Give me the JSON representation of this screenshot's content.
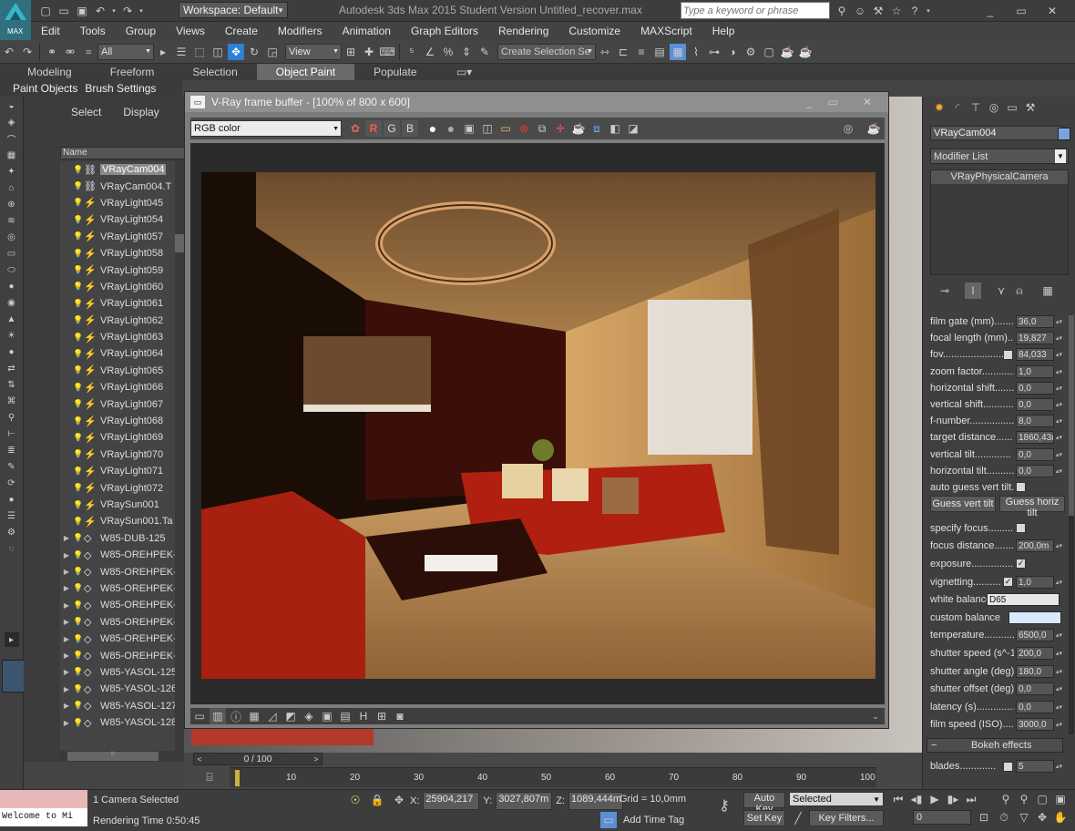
{
  "app": {
    "title": "Autodesk 3ds Max  2015   Student Version   Untitled_recover.max",
    "workspace": "Workspace: Default",
    "search_placeholder": "Type a keyword or phrase",
    "logo": "MAX"
  },
  "menu": [
    "Edit",
    "Tools",
    "Group",
    "Views",
    "Create",
    "Modifiers",
    "Animation",
    "Graph Editors",
    "Rendering",
    "Customize",
    "MAXScript",
    "Help"
  ],
  "toolbar": {
    "filter": "All",
    "ref_coord": "View",
    "selection_set": "Create Selection Se"
  },
  "ribbon": {
    "tabs": [
      "Modeling",
      "Freeform",
      "Selection",
      "Object Paint",
      "Populate"
    ],
    "active": "Object Paint",
    "subtabs": [
      "Paint Objects",
      "Brush Settings"
    ]
  },
  "explorer": {
    "tabs": [
      "Select",
      "Display"
    ],
    "column": "Name",
    "nodes": [
      {
        "label": "VRayCam004",
        "type": "camera",
        "selected": true,
        "expandable": false
      },
      {
        "label": "VRayCam004.T",
        "type": "camera",
        "selected": false,
        "expandable": false
      },
      {
        "label": "VRayLight045",
        "type": "light",
        "selected": false,
        "expandable": false
      },
      {
        "label": "VRayLight054",
        "type": "light",
        "selected": false,
        "expandable": false
      },
      {
        "label": "VRayLight057",
        "type": "light",
        "selected": false,
        "expandable": false
      },
      {
        "label": "VRayLight058",
        "type": "light",
        "selected": false,
        "expandable": false
      },
      {
        "label": "VRayLight059",
        "type": "light",
        "selected": false,
        "expandable": false
      },
      {
        "label": "VRayLight060",
        "type": "light",
        "selected": false,
        "expandable": false
      },
      {
        "label": "VRayLight061",
        "type": "light",
        "selected": false,
        "expandable": false
      },
      {
        "label": "VRayLight062",
        "type": "light",
        "selected": false,
        "expandable": false
      },
      {
        "label": "VRayLight063",
        "type": "light",
        "selected": false,
        "expandable": false
      },
      {
        "label": "VRayLight064",
        "type": "light",
        "selected": false,
        "expandable": false
      },
      {
        "label": "VRayLight065",
        "type": "light",
        "selected": false,
        "expandable": false
      },
      {
        "label": "VRayLight066",
        "type": "light",
        "selected": false,
        "expandable": false
      },
      {
        "label": "VRayLight067",
        "type": "light",
        "selected": false,
        "expandable": false
      },
      {
        "label": "VRayLight068",
        "type": "light",
        "selected": false,
        "expandable": false
      },
      {
        "label": "VRayLight069",
        "type": "light",
        "selected": false,
        "expandable": false
      },
      {
        "label": "VRayLight070",
        "type": "light",
        "selected": false,
        "expandable": false
      },
      {
        "label": "VRayLight071",
        "type": "light",
        "selected": false,
        "expandable": false
      },
      {
        "label": "VRayLight072",
        "type": "light",
        "selected": false,
        "expandable": false
      },
      {
        "label": "VRaySun001",
        "type": "light",
        "selected": false,
        "expandable": false
      },
      {
        "label": "VRaySun001.Ta",
        "type": "light",
        "selected": false,
        "expandable": false
      },
      {
        "label": "W85-DUB-125",
        "type": "mesh",
        "selected": false,
        "expandable": true
      },
      {
        "label": "W85-OREHPEK-",
        "type": "mesh",
        "selected": false,
        "expandable": true
      },
      {
        "label": "W85-OREHPEK-",
        "type": "mesh",
        "selected": false,
        "expandable": true
      },
      {
        "label": "W85-OREHPEK-",
        "type": "mesh",
        "selected": false,
        "expandable": true
      },
      {
        "label": "W85-OREHPEK-",
        "type": "mesh",
        "selected": false,
        "expandable": true
      },
      {
        "label": "W85-OREHPEK-",
        "type": "mesh",
        "selected": false,
        "expandable": true
      },
      {
        "label": "W85-OREHPEK-",
        "type": "mesh",
        "selected": false,
        "expandable": true
      },
      {
        "label": "W85-OREHPEK-",
        "type": "mesh",
        "selected": false,
        "expandable": true
      },
      {
        "label": "W85-YASOL-125",
        "type": "mesh",
        "selected": false,
        "expandable": true
      },
      {
        "label": "W85-YASOL-126",
        "type": "mesh",
        "selected": false,
        "expandable": true
      },
      {
        "label": "W85-YASOL-127",
        "type": "mesh",
        "selected": false,
        "expandable": true
      },
      {
        "label": "W85-YASOL-128",
        "type": "mesh",
        "selected": false,
        "expandable": true
      }
    ]
  },
  "framebuffer": {
    "title": "V-Ray frame buffer - [100% of 800 x 600]",
    "channel": "RGB color",
    "r": "R",
    "g": "G",
    "b": "B"
  },
  "command_panel": {
    "object_name": "VRayCam004",
    "modifier_list": "Modifier List",
    "stack_item": "VRayPhysicalCamera",
    "params": [
      {
        "label": "film gate (mm)........",
        "value": "36,0",
        "kind": "spinner"
      },
      {
        "label": "focal length (mm)....",
        "value": "19,827",
        "kind": "spinner"
      },
      {
        "label": "fov.........................",
        "value": "84,033",
        "kind": "spinner-check",
        "checked": false
      },
      {
        "label": "zoom factor.............",
        "value": "1,0",
        "kind": "spinner"
      },
      {
        "label": "horizontal shift........",
        "value": "0,0",
        "kind": "spinner"
      },
      {
        "label": "vertical shift...........",
        "value": "0,0",
        "kind": "spinner"
      },
      {
        "label": "f-number.................",
        "value": "8,0",
        "kind": "spinner"
      },
      {
        "label": "target distance......",
        "value": "1860,43r",
        "kind": "spinner"
      },
      {
        "label": "vertical tilt.............",
        "value": "0,0",
        "kind": "spinner"
      },
      {
        "label": "horizontal tilt..........",
        "value": "0,0",
        "kind": "spinner"
      },
      {
        "label": "auto guess vert tilt..",
        "value": "",
        "kind": "check",
        "checked": false
      }
    ],
    "guess_vert": "Guess vert tilt",
    "guess_horiz": "Guess horiz tilt",
    "params2": [
      {
        "label": "specify focus..........",
        "value": "",
        "kind": "check",
        "checked": false
      },
      {
        "label": "focus distance........",
        "value": "200,0m",
        "kind": "spinner"
      },
      {
        "label": "exposure.................",
        "value": "",
        "kind": "check",
        "checked": true
      },
      {
        "label": "vignetting..........",
        "value": "1,0",
        "kind": "spinner-check",
        "checked": true
      },
      {
        "label": "white balance",
        "value": "D65",
        "kind": "dropdown"
      },
      {
        "label": "custom balance",
        "value": "",
        "kind": "swatch"
      },
      {
        "label": "temperature............",
        "value": "6500,0",
        "kind": "spinner"
      },
      {
        "label": "shutter speed (s^-1",
        "value": "200,0",
        "kind": "spinner"
      },
      {
        "label": "shutter angle (deg).",
        "value": "180,0",
        "kind": "spinner"
      },
      {
        "label": "shutter offset (deg)",
        "value": "0,0",
        "kind": "spinner"
      },
      {
        "label": "latency (s)..............",
        "value": "0,0",
        "kind": "spinner"
      },
      {
        "label": "film speed (ISO).....",
        "value": "3000,0",
        "kind": "spinner"
      }
    ],
    "rollout": "Bokeh effects",
    "blades_label": "blades.............",
    "blades_value": "5"
  },
  "timeline": {
    "frame": "0 / 100",
    "ticks": [
      "10",
      "20",
      "30",
      "40",
      "50",
      "60",
      "70",
      "80",
      "90",
      "100"
    ]
  },
  "status": {
    "selection": "1 Camera Selected",
    "render_time": "Rendering Time  0:50:45",
    "maxscript": "Welcome to Mi",
    "x_label": "X:",
    "x": "25904,217",
    "y_label": "Y:",
    "y": "3027,807m",
    "z_label": "Z:",
    "z": "1089,444m",
    "grid": "Grid = 10,0mm",
    "add_time_tag": "Add Time Tag",
    "auto_key": "Auto Key",
    "set_key": "Set Key",
    "key_mode": "Selected",
    "key_filters": "Key Filters...",
    "frame_field": "0"
  },
  "colors": {
    "accent": "#5b8fd6",
    "selected_tool": "#2e7fd8",
    "bulb": "#f2e45a"
  }
}
